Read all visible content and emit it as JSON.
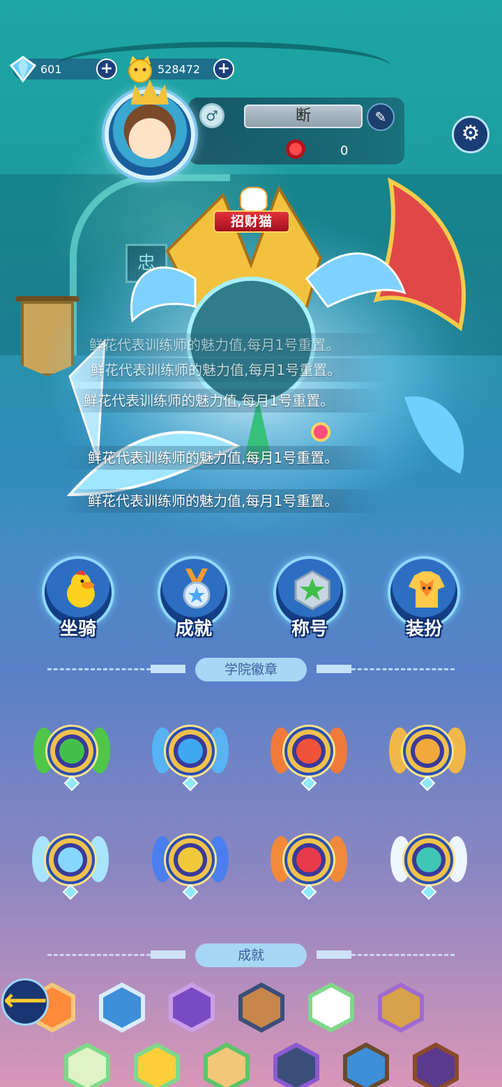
{
  "currency": {
    "diamonds": "601",
    "coins": "528472"
  },
  "profile": {
    "name": "断",
    "flowers": "0",
    "pet_tag": "招财猫"
  },
  "tooltip": {
    "lines": [
      "鲜花代表训练师的魅力值,每月1号重置。",
      "鲜花代表训练师的魅力值,每月1号重置。",
      "鲜花代表训练师的魅力值,每月1号重置。",
      "鲜花代表训练师的魅力值,每月1号重置。",
      "鲜花代表训练师的魅力值,每月1号重置。"
    ]
  },
  "features": [
    {
      "label": "坐骑",
      "icon": "duck-mount-icon"
    },
    {
      "label": "成就",
      "icon": "medal-icon"
    },
    {
      "label": "称号",
      "icon": "star-title-icon"
    },
    {
      "label": "装扮",
      "icon": "fox-outfit-icon"
    }
  ],
  "sections": {
    "academy_badges": "学院徽章",
    "achievements": "成就"
  },
  "badges": [
    {
      "icon": "leaf-badge-icon",
      "accent": "#43c04a"
    },
    {
      "icon": "water-badge-icon",
      "accent": "#3fa7f0"
    },
    {
      "icon": "fire-badge-icon",
      "accent": "#f0533a"
    },
    {
      "icon": "earth-badge-icon",
      "accent": "#f0a93a"
    },
    {
      "icon": "ice-badge-icon",
      "accent": "#86d6ff"
    },
    {
      "icon": "thunder-badge-icon",
      "accent": "#f0c93a"
    },
    {
      "icon": "flame-badge-icon",
      "accent": "#e83a4a"
    },
    {
      "icon": "wind-badge-icon",
      "accent": "#40c6b6"
    }
  ],
  "achievement_icons": [
    "orange-creature-hex-icon",
    "star-medal-hex-icon",
    "dice-hex-icon",
    "monkey-hex-icon",
    "cat-hex-icon",
    "bear-hex-icon",
    "balloons-hex-icon",
    "coin-hex-icon",
    "fighter-hex-icon",
    "boy-hex-icon",
    "gift-hex-icon",
    "knight-hex-icon"
  ]
}
